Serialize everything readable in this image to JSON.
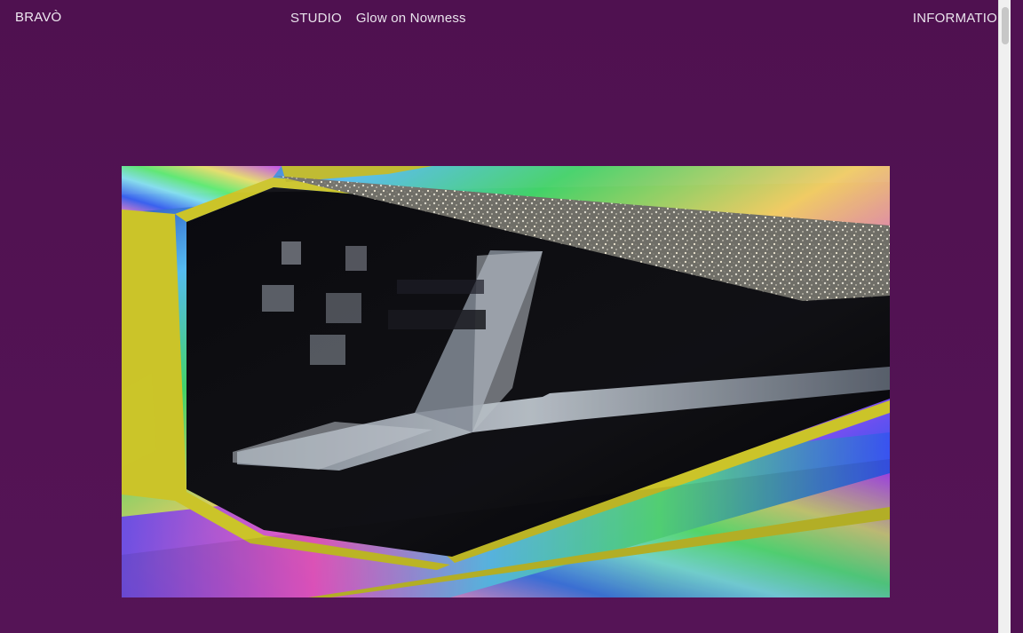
{
  "nav": {
    "brand": "BRAVÒ",
    "studio": "STUDIO",
    "project": "Glow on Nowness",
    "information": "INFORMATION"
  },
  "colors": {
    "background": "#501252",
    "text": "#e9e3ec"
  },
  "icons": {
    "scroll": "scrollbar-thumb"
  }
}
